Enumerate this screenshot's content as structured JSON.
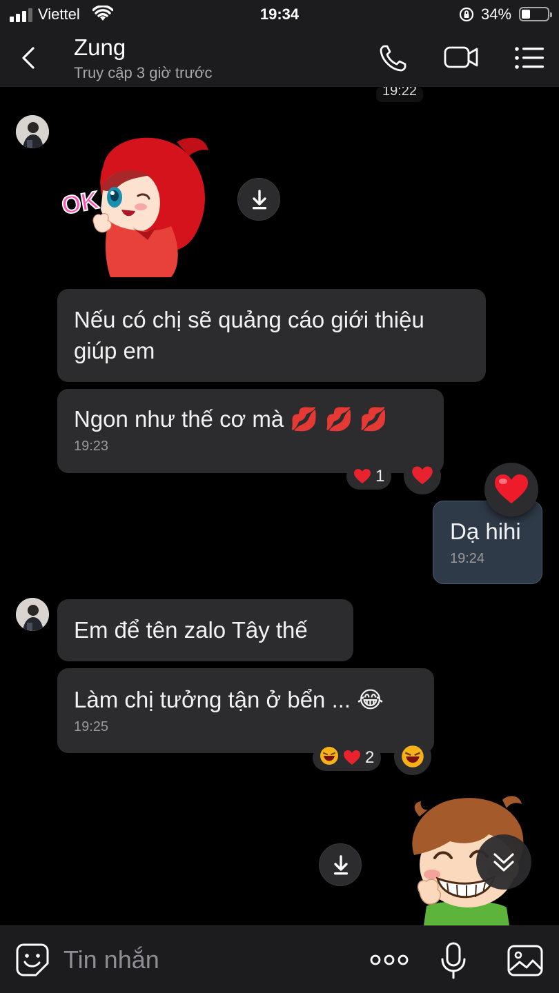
{
  "status_bar": {
    "carrier": "Viettel",
    "time": "19:34",
    "battery_percent_text": "34%",
    "battery_level": 0.34
  },
  "header": {
    "contact_name": "Zung",
    "contact_status": "Truy cập 3 giờ trước",
    "icons": [
      "back-icon",
      "phone-icon",
      "video-call-icon",
      "menu-icon"
    ]
  },
  "chat": {
    "top_timestamp": "19:22",
    "messages": [
      {
        "sender": "contact",
        "type": "sticker",
        "sticker_text": "OK"
      },
      {
        "sender": "contact",
        "type": "text",
        "text_line1": "Nếu có chị sẽ quảng cáo giới thiệu",
        "text_line2": "giúp em"
      },
      {
        "sender": "contact",
        "type": "text",
        "text": "Ngon như thế cơ mà 💋 💋 💋",
        "time": "19:23",
        "reaction_count": "1"
      },
      {
        "sender": "me",
        "type": "text",
        "text": "Dạ hihi",
        "time": "19:24"
      },
      {
        "sender": "contact",
        "type": "text",
        "text": "Em để tên zalo Tây thế"
      },
      {
        "sender": "contact",
        "type": "text",
        "text": "Làm chị tưởng tận ở bển ... 😂",
        "time": "19:25",
        "reaction_count": "2"
      },
      {
        "sender": "me",
        "type": "sticker"
      }
    ]
  },
  "input_bar": {
    "placeholder": "Tin nhắn",
    "icons": [
      "sticker-icon",
      "more-icon",
      "mic-icon",
      "image-icon"
    ]
  },
  "colors": {
    "background": "#000000",
    "bar": "#1c1c1e",
    "bubble_contact": "#2c2c2e",
    "bubble_me": "#2f3a48",
    "heart": "#e8232f"
  }
}
